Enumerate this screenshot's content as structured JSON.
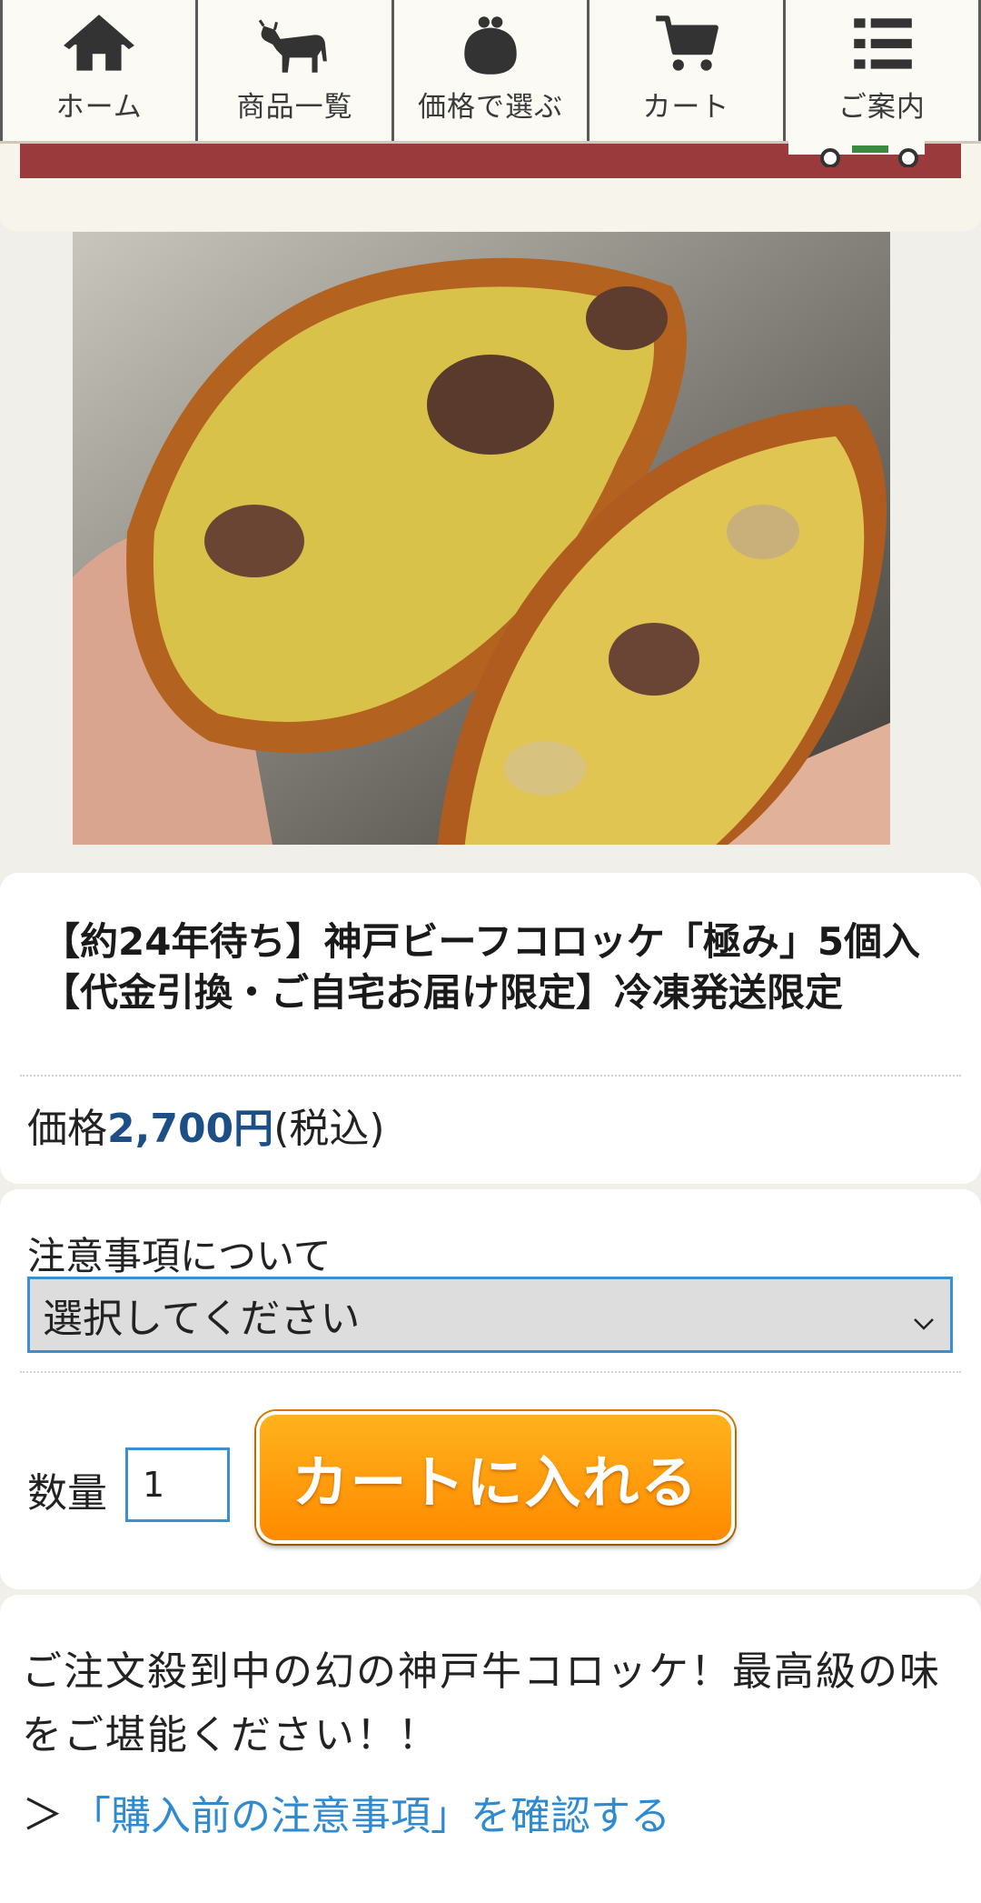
{
  "nav": {
    "items": [
      {
        "label": "ホーム",
        "icon": "home-icon"
      },
      {
        "label": "商品一覧",
        "icon": "cow-icon"
      },
      {
        "label": "価格で選ぶ",
        "icon": "purse-icon"
      },
      {
        "label": "カート",
        "icon": "cart-icon"
      },
      {
        "label": "ご案内",
        "icon": "list-icon"
      }
    ]
  },
  "colors": {
    "header_red": "#9a3a3c",
    "price_blue": "#1c4f86",
    "link_blue": "#2f8ad0",
    "button_orange": "#ff9a0a",
    "focus_border": "#3a8fd0"
  },
  "product": {
    "image_alt": "神戸ビーフコロッケ",
    "title": "【約24年待ち】神戸ビーフコロッケ「極み」5個入 【代金引換・ご自宅お届け限定】冷凍発送限定",
    "price_label": "価格",
    "price_value": "2,700円",
    "price_tax": "(税込)"
  },
  "options": {
    "notice_label": "注意事項について",
    "select_value": "選択してください",
    "quantity_label": "数量",
    "quantity_value": "1",
    "cart_button_label": "カートに入れる"
  },
  "description": {
    "text": "ご注文殺到中の幻の神戸牛コロッケ！最高級の味をご堪能ください！！",
    "link_arrow": "＞",
    "link_text": "「購入前の注意事項」を確認する"
  }
}
